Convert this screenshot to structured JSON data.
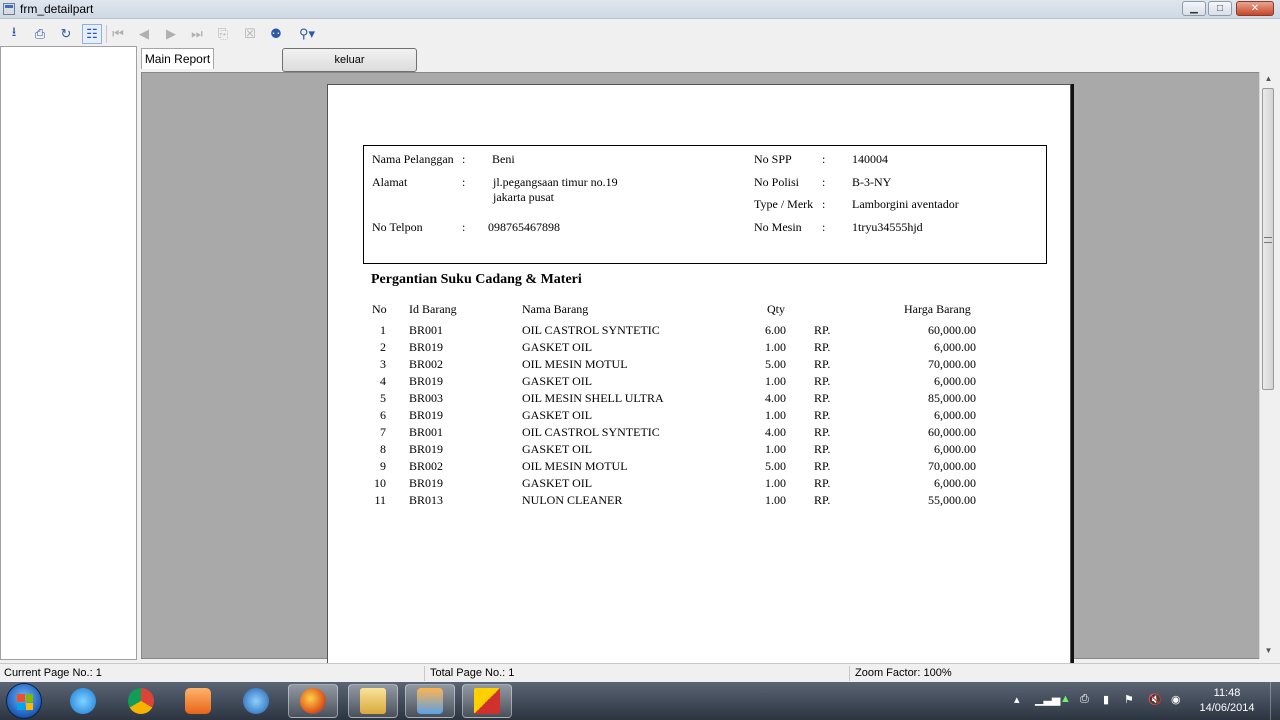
{
  "window": {
    "title": "frm_detailpart"
  },
  "toolbar": {
    "icons": [
      "export-icon",
      "print-icon",
      "refresh-icon",
      "group-tree-icon",
      "first-page-icon",
      "prev-page-icon",
      "next-page-icon",
      "last-page-icon",
      "goto-page-icon",
      "stop-icon",
      "search-icon",
      "zoom-icon"
    ]
  },
  "tabs": {
    "main_report": "Main Report"
  },
  "buttons": {
    "keluar": "keluar"
  },
  "report": {
    "info": {
      "nama_pelanggan_label": "Nama Pelanggan",
      "nama_pelanggan_value": "Beni",
      "alamat_label": "Alamat",
      "alamat_value_line1": "jl.pegangsaan timur no.19",
      "alamat_value_line2": "jakarta pusat",
      "no_telpon_label": "No Telpon",
      "no_telpon_value": "098765467898",
      "no_spp_label": "No SPP",
      "no_spp_value": "140004",
      "no_polisi_label": "No Polisi",
      "no_polisi_value": "B-3-NY",
      "type_merk_label": "Type / Merk",
      "type_merk_value": "Lamborgini aventador",
      "no_mesin_label": "No Mesin",
      "no_mesin_value": "1tryu34555hjd",
      "colon": ":"
    },
    "section_title": "Pergantian Suku Cadang & Materi",
    "columns": {
      "no": "No",
      "id_barang": "Id Barang",
      "nama_barang": "Nama Barang",
      "qty": "Qty",
      "harga_barang": "Harga Barang"
    },
    "currency": "RP.",
    "rows": [
      {
        "no": "1",
        "id": "BR001",
        "nama": "OIL CASTROL SYNTETIC",
        "qty": "6.00",
        "harga": "60,000.00"
      },
      {
        "no": "2",
        "id": "BR019",
        "nama": "GASKET OIL",
        "qty": "1.00",
        "harga": "6,000.00"
      },
      {
        "no": "3",
        "id": "BR002",
        "nama": "OIL MESIN MOTUL",
        "qty": "5.00",
        "harga": "70,000.00"
      },
      {
        "no": "4",
        "id": "BR019",
        "nama": "GASKET OIL",
        "qty": "1.00",
        "harga": "6,000.00"
      },
      {
        "no": "5",
        "id": "BR003",
        "nama": "OIL MESIN SHELL ULTRA",
        "qty": "4.00",
        "harga": "85,000.00"
      },
      {
        "no": "6",
        "id": "BR019",
        "nama": "GASKET OIL",
        "qty": "1.00",
        "harga": "6,000.00"
      },
      {
        "no": "7",
        "id": "BR001",
        "nama": "OIL CASTROL SYNTETIC",
        "qty": "4.00",
        "harga": "60,000.00"
      },
      {
        "no": "8",
        "id": "BR019",
        "nama": "GASKET OIL",
        "qty": "1.00",
        "harga": "6,000.00"
      },
      {
        "no": "9",
        "id": "BR002",
        "nama": "OIL MESIN MOTUL",
        "qty": "5.00",
        "harga": "70,000.00"
      },
      {
        "no": "10",
        "id": "BR019",
        "nama": "GASKET OIL",
        "qty": "1.00",
        "harga": "6,000.00"
      },
      {
        "no": "11",
        "id": "BR013",
        "nama": "NULON CLEANER",
        "qty": "1.00",
        "harga": "55,000.00"
      }
    ]
  },
  "status": {
    "current_page": "Current Page No.: 1",
    "total_page": "Total Page No.: 1",
    "zoom": "Zoom Factor: 100%"
  },
  "taskbar": {
    "apps": [
      "internet-explorer-icon",
      "chrome-icon",
      "media-player-icon",
      "visual-studio-icon",
      "firefox-icon",
      "file-explorer-icon",
      "tool-app-icon",
      "report-app-icon"
    ],
    "clock_time": "11:48",
    "clock_date": "14/06/2014"
  },
  "colors": {
    "accent": "#2a5aa8",
    "viewer_bg": "#a9a9a9",
    "page_bg": "#ffffff"
  }
}
